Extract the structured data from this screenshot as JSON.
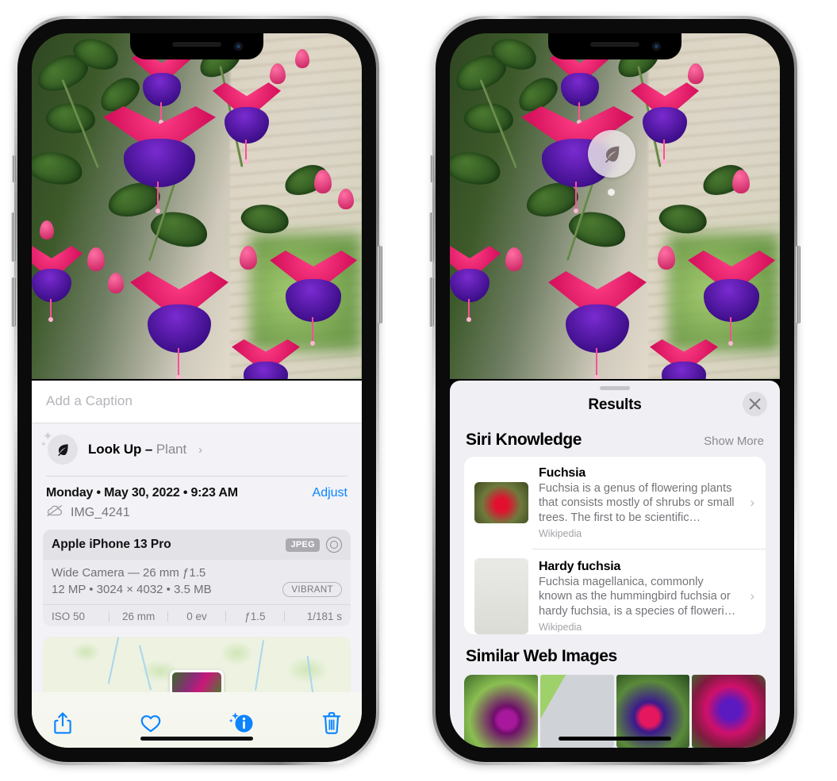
{
  "left_phone": {
    "caption": {
      "placeholder": "Add a Caption",
      "value": ""
    },
    "lookup": {
      "label": "Look Up – ",
      "subject": "Plant",
      "chevron": "›",
      "icon": "leaf-icon"
    },
    "date_line": "Monday • May 30, 2022 • 9:23 AM",
    "adjust_label": "Adjust",
    "file_name": "IMG_4241",
    "file_icon": "icloud-slash-icon",
    "camera": {
      "model": "Apple iPhone 13 Pro",
      "format_tag": "JPEG",
      "raw_icon": "aperture-icon",
      "lens_line": "Wide Camera — 26 mm ƒ1.5",
      "spec_line": "12 MP • 3024 × 4032 • 3.5 MB",
      "style_tag": "VIBRANT",
      "exif": [
        "ISO 50",
        "26 mm",
        "0 ev",
        "ƒ1.5",
        "1/181 s"
      ]
    },
    "toolbar": [
      {
        "name": "share-button",
        "icon": "share-icon"
      },
      {
        "name": "favorite-button",
        "icon": "heart-icon"
      },
      {
        "name": "info-button",
        "icon": "info-sparkle-icon"
      },
      {
        "name": "delete-button",
        "icon": "trash-icon"
      }
    ]
  },
  "right_phone": {
    "badge": {
      "icon": "leaf-icon"
    },
    "sheet": {
      "title": "Results",
      "close_icon": "close-icon",
      "sections": [
        {
          "title": "Siri Knowledge",
          "action": "Show More",
          "items": [
            {
              "title": "Fuchsia",
              "description": "Fuchsia is a genus of flowering plants that consists mostly of shrubs or small trees. The first to be scientific…",
              "source": "Wikipedia",
              "chevron": "›"
            },
            {
              "title": "Hardy fuchsia",
              "description": "Fuchsia magellanica, commonly known as the hummingbird fuchsia or hardy fuchsia, is a species of floweri…",
              "source": "Wikipedia",
              "chevron": "›"
            }
          ]
        },
        {
          "title": "Similar Web Images",
          "thumbs": [
            "web-image-1",
            "web-image-2",
            "web-image-3",
            "web-image-4"
          ]
        }
      ]
    }
  },
  "colors": {
    "accent": "#0a84ff",
    "panel_bg": "#f2f2f7",
    "sheet_bg": "#efeff4",
    "card_bg": "#ffffff",
    "secondary_text": "#8a8a8f"
  }
}
